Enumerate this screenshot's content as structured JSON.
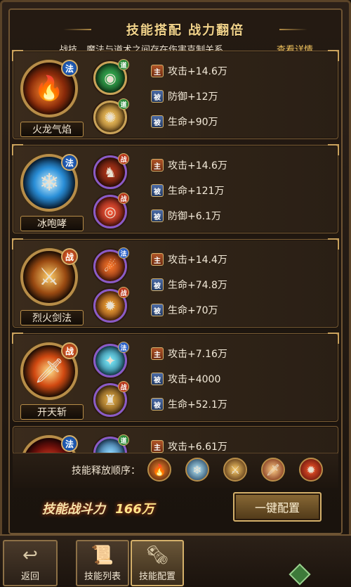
{
  "header": {
    "title": "技能搭配 战力翻倍",
    "subtitle": "战技、魔法与道术之间存在伤害克制关系",
    "detail_link": "查看详情"
  },
  "cards": [
    {
      "name": "火龙气焰",
      "type_badge": "法",
      "main_icon": "fire-dragon-icon",
      "subs": [
        {
          "icon": "green-vortex-icon",
          "badge": "道"
        },
        {
          "icon": "gold-swirl-icon",
          "badge": "道"
        }
      ],
      "stats": [
        {
          "tag": "主",
          "text": "攻击+14.6万"
        },
        {
          "tag": "被",
          "text": "防御+12万"
        },
        {
          "tag": "被",
          "text": "生命+90万"
        }
      ]
    },
    {
      "name": "冰咆哮",
      "type_badge": "法",
      "main_icon": "ice-burst-icon",
      "subs": [
        {
          "icon": "warrior-figure-icon",
          "badge": "战"
        },
        {
          "icon": "red-spiral-icon",
          "badge": "战"
        }
      ],
      "stats": [
        {
          "tag": "主",
          "text": "攻击+14.6万"
        },
        {
          "tag": "被",
          "text": "生命+121万"
        },
        {
          "tag": "被",
          "text": "防御+6.1万"
        }
      ]
    },
    {
      "name": "烈火剑法",
      "type_badge": "战",
      "main_icon": "flame-swords-icon",
      "subs": [
        {
          "icon": "flame-strike-icon",
          "badge": "法"
        },
        {
          "icon": "fire-star-icon",
          "badge": "战"
        }
      ],
      "stats": [
        {
          "tag": "主",
          "text": "攻击+14.4万"
        },
        {
          "tag": "被",
          "text": "生命+74.8万"
        },
        {
          "tag": "被",
          "text": "生命+70万"
        }
      ]
    },
    {
      "name": "开天斩",
      "type_badge": "战",
      "main_icon": "sky-slash-icon",
      "subs": [
        {
          "icon": "cyan-splash-icon",
          "badge": "法"
        },
        {
          "icon": "golden-cauldron-icon",
          "badge": "战"
        }
      ],
      "stats": [
        {
          "tag": "主",
          "text": "攻击+7.16万"
        },
        {
          "tag": "被",
          "text": "攻击+4000"
        },
        {
          "tag": "被",
          "text": "生命+52.1万"
        }
      ]
    },
    {
      "name": "",
      "type_badge": "法",
      "main_icon": "red-orb-icon",
      "subs": [
        {
          "icon": "blue-orb-icon",
          "badge": "道"
        }
      ],
      "stats": [
        {
          "tag": "主",
          "text": "攻击+6.61万"
        }
      ]
    }
  ],
  "order": {
    "label": "技能释放顺序：",
    "icons": [
      "fire-dragon-icon",
      "ice-burst-icon",
      "flame-swords-icon",
      "sky-slash-icon",
      "red-orb-icon"
    ]
  },
  "power": {
    "label": "技能战斗力",
    "value": "166万"
  },
  "oneclick": {
    "label": "一键配置"
  },
  "nav": {
    "back": "返回",
    "skill_list": "技能列表",
    "skill_config": "技能配置"
  },
  "colors": {
    "gold": "#f0c35e",
    "panel": "#2f2317",
    "border": "#7a5c34"
  }
}
